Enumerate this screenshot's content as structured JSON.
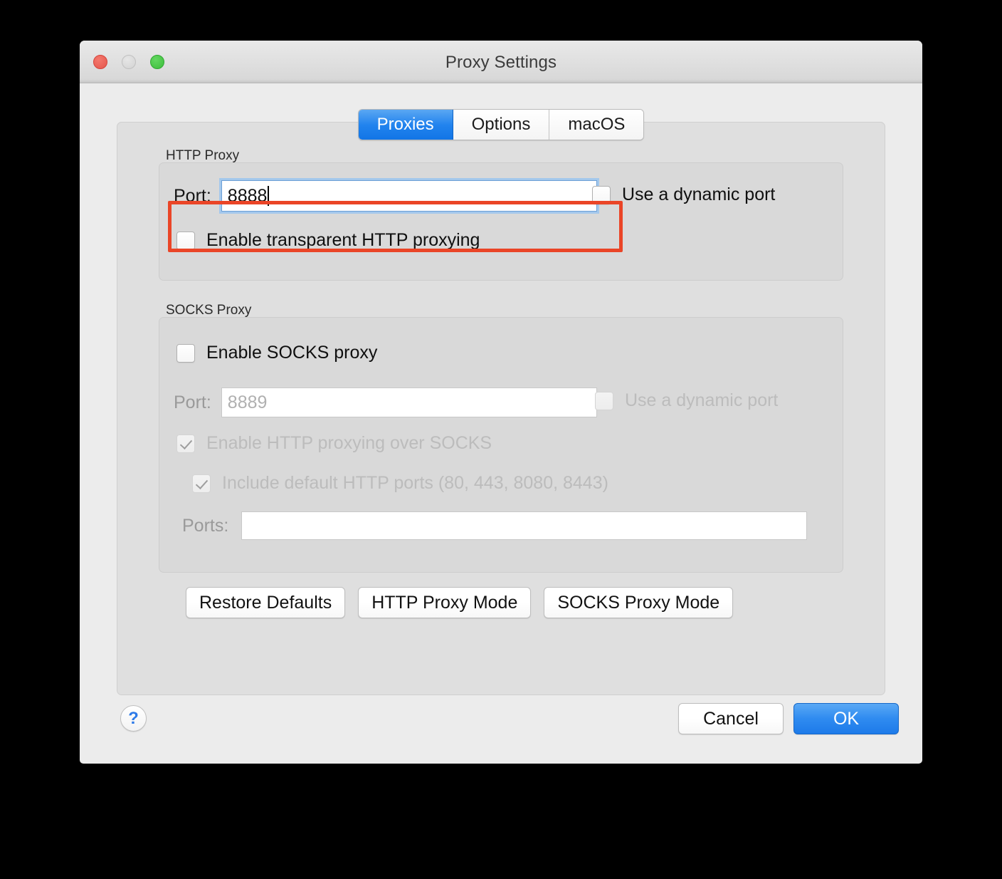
{
  "window": {
    "title": "Proxy Settings",
    "traffic_lights": [
      "close-button",
      "minimize-button",
      "maximize-button"
    ]
  },
  "tabs": [
    {
      "label": "Proxies",
      "selected": true
    },
    {
      "label": "Options",
      "selected": false
    },
    {
      "label": "macOS",
      "selected": false
    }
  ],
  "http_proxy": {
    "group_label": "HTTP Proxy",
    "port_label": "Port:",
    "port_value": "8888",
    "dynamic_port_label": "Use a dynamic port",
    "dynamic_port_checked": false,
    "transparent_label": "Enable transparent HTTP proxying",
    "transparent_checked": false
  },
  "socks_proxy": {
    "group_label": "SOCKS Proxy",
    "enable_label": "Enable SOCKS proxy",
    "enable_checked": false,
    "port_label": "Port:",
    "port_value": "8889",
    "dynamic_port_label": "Use a dynamic port",
    "dynamic_port_checked": false,
    "http_over_socks_label": "Enable HTTP proxying over SOCKS",
    "http_over_socks_checked": true,
    "default_ports_label": "Include default HTTP ports (80, 443, 8080, 8443)",
    "default_ports_checked": true,
    "ports_label": "Ports:",
    "ports_value": ""
  },
  "mode_buttons": {
    "restore_defaults": "Restore Defaults",
    "http_proxy_mode": "HTTP Proxy Mode",
    "socks_proxy_mode": "SOCKS Proxy Mode"
  },
  "footer": {
    "help_label": "?",
    "cancel_label": "Cancel",
    "ok_label": "OK"
  },
  "annotation": {
    "color": "#ea4527",
    "target": "http-proxy-port-row"
  }
}
